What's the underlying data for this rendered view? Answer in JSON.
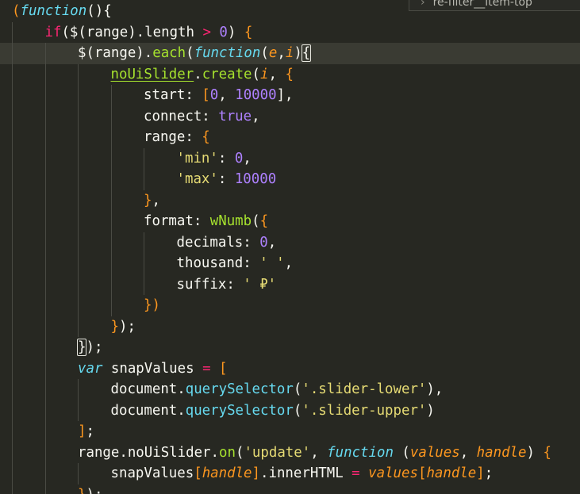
{
  "editor": {
    "theme": "Monokai",
    "colors": {
      "background": "#272822",
      "keyword": "#f92672",
      "function": "#66d9ef",
      "string": "#e6db74",
      "number": "#ae81ff",
      "parameter": "#fd971f",
      "call": "#a6e22e",
      "text": "#f8f8f2"
    },
    "current_line": 3,
    "overlay_text": "re-filter__item-top"
  },
  "lines": [
    {
      "indent": 0,
      "tokens": [
        [
          "(",
          "brk"
        ],
        [
          "function",
          "fn"
        ],
        [
          "(){",
          "pun"
        ]
      ]
    },
    {
      "indent": 1,
      "tokens": [
        [
          "if",
          "kw"
        ],
        [
          "($(range).length ",
          "pun"
        ],
        [
          ">",
          "kw"
        ],
        [
          " ",
          "pun"
        ],
        [
          "0",
          "num"
        ],
        [
          ") ",
          "pun"
        ],
        [
          "{",
          "brk"
        ]
      ]
    },
    {
      "indent": 2,
      "tokens": [
        [
          "$(range).",
          "pun"
        ],
        [
          "each",
          "fnc"
        ],
        [
          "(",
          "pun"
        ],
        [
          "function",
          "fn"
        ],
        [
          "(",
          "pun"
        ],
        [
          "e",
          "par"
        ],
        [
          ",",
          "pun"
        ],
        [
          "i",
          "par"
        ],
        [
          ")",
          "pun"
        ],
        [
          "{",
          "pun match"
        ]
      ]
    },
    {
      "indent": 3,
      "tokens": [
        [
          "noUiSlider",
          "fnc ul"
        ],
        [
          ".",
          "pun"
        ],
        [
          "create",
          "fnc"
        ],
        [
          "(",
          "pun"
        ],
        [
          "i",
          "par"
        ],
        [
          ", ",
          "pun"
        ],
        [
          "{",
          "brk"
        ]
      ]
    },
    {
      "indent": 4,
      "tokens": [
        [
          "start: ",
          "pun"
        ],
        [
          "[",
          "brk"
        ],
        [
          "0",
          "num"
        ],
        [
          ", ",
          "pun"
        ],
        [
          "10000",
          "num"
        ],
        [
          "],",
          "pun"
        ]
      ]
    },
    {
      "indent": 4,
      "tokens": [
        [
          "connect: ",
          "pun"
        ],
        [
          "true",
          "con"
        ],
        [
          ",",
          "pun"
        ]
      ]
    },
    {
      "indent": 4,
      "tokens": [
        [
          "range: ",
          "pun"
        ],
        [
          "{",
          "brk"
        ]
      ]
    },
    {
      "indent": 5,
      "tokens": [
        [
          "'min'",
          "str"
        ],
        [
          ": ",
          "pun"
        ],
        [
          "0",
          "num"
        ],
        [
          ",",
          "pun"
        ]
      ]
    },
    {
      "indent": 5,
      "tokens": [
        [
          "'max'",
          "str"
        ],
        [
          ": ",
          "pun"
        ],
        [
          "10000",
          "num"
        ]
      ]
    },
    {
      "indent": 4,
      "tokens": [
        [
          "}",
          "brk"
        ],
        [
          ",",
          "pun"
        ]
      ]
    },
    {
      "indent": 4,
      "tokens": [
        [
          "format: ",
          "pun"
        ],
        [
          "wNumb",
          "fnc"
        ],
        [
          "(",
          "pun"
        ],
        [
          "{",
          "brk"
        ]
      ]
    },
    {
      "indent": 5,
      "tokens": [
        [
          "decimals: ",
          "pun"
        ],
        [
          "0",
          "num"
        ],
        [
          ",",
          "pun"
        ]
      ]
    },
    {
      "indent": 5,
      "tokens": [
        [
          "thousand: ",
          "pun"
        ],
        [
          "' '",
          "str"
        ],
        [
          ",",
          "pun"
        ]
      ]
    },
    {
      "indent": 5,
      "tokens": [
        [
          "suffix: ",
          "pun"
        ],
        [
          "' ₽'",
          "str"
        ]
      ]
    },
    {
      "indent": 4,
      "tokens": [
        [
          "})",
          "brk"
        ]
      ]
    },
    {
      "indent": 3,
      "tokens": [
        [
          "}",
          "brk"
        ],
        [
          ");",
          "pun"
        ]
      ]
    },
    {
      "indent": 2,
      "tokens": [
        [
          "}",
          "pun match"
        ],
        [
          ");",
          "pun"
        ]
      ]
    },
    {
      "indent": 2,
      "tokens": [
        [
          "var",
          "fn"
        ],
        [
          " snapValues ",
          "pun"
        ],
        [
          "=",
          "kw"
        ],
        [
          " ",
          "pun"
        ],
        [
          "[",
          "brk"
        ]
      ]
    },
    {
      "indent": 3,
      "tokens": [
        [
          "document.",
          "pun"
        ],
        [
          "querySelector",
          "met"
        ],
        [
          "(",
          "pun"
        ],
        [
          "'.slider-lower'",
          "str"
        ],
        [
          "),",
          "pun"
        ]
      ]
    },
    {
      "indent": 3,
      "tokens": [
        [
          "document.",
          "pun"
        ],
        [
          "querySelector",
          "met"
        ],
        [
          "(",
          "pun"
        ],
        [
          "'.slider-upper'",
          "str"
        ],
        [
          ")",
          "pun"
        ]
      ]
    },
    {
      "indent": 2,
      "tokens": [
        [
          "]",
          "brk"
        ],
        [
          ";",
          "pun"
        ]
      ]
    },
    {
      "indent": 2,
      "tokens": [
        [
          "range.noUiSlider.",
          "pun"
        ],
        [
          "on",
          "fnc"
        ],
        [
          "(",
          "pun"
        ],
        [
          "'update'",
          "str"
        ],
        [
          ", ",
          "pun"
        ],
        [
          "function",
          "fn"
        ],
        [
          " (",
          "pun"
        ],
        [
          "values",
          "par"
        ],
        [
          ", ",
          "pun"
        ],
        [
          "handle",
          "par"
        ],
        [
          ") ",
          "pun"
        ],
        [
          "{",
          "brk"
        ]
      ]
    },
    {
      "indent": 3,
      "tokens": [
        [
          "snapValues",
          "pun"
        ],
        [
          "[",
          "brk"
        ],
        [
          "handle",
          "par"
        ],
        [
          "]",
          "brk"
        ],
        [
          ".innerHTML ",
          "pun"
        ],
        [
          "=",
          "kw"
        ],
        [
          " ",
          "pun"
        ],
        [
          "values",
          "par"
        ],
        [
          "[",
          "brk"
        ],
        [
          "handle",
          "par"
        ],
        [
          "]",
          "brk"
        ],
        [
          ";",
          "pun"
        ]
      ]
    },
    {
      "indent": 2,
      "tokens": [
        [
          "}",
          "brk"
        ],
        [
          ");",
          "pun"
        ]
      ]
    }
  ]
}
